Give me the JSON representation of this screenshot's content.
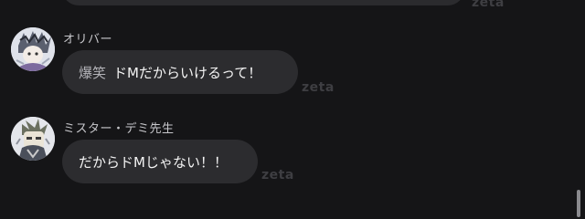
{
  "watermark": "zeta",
  "messages": [
    {
      "sender": "オリバー",
      "emphasis": "爆笑",
      "text": "ドMだからいけるって！"
    },
    {
      "sender": "ミスター・デミ先生",
      "text": "だからドMじゃない！！"
    }
  ]
}
